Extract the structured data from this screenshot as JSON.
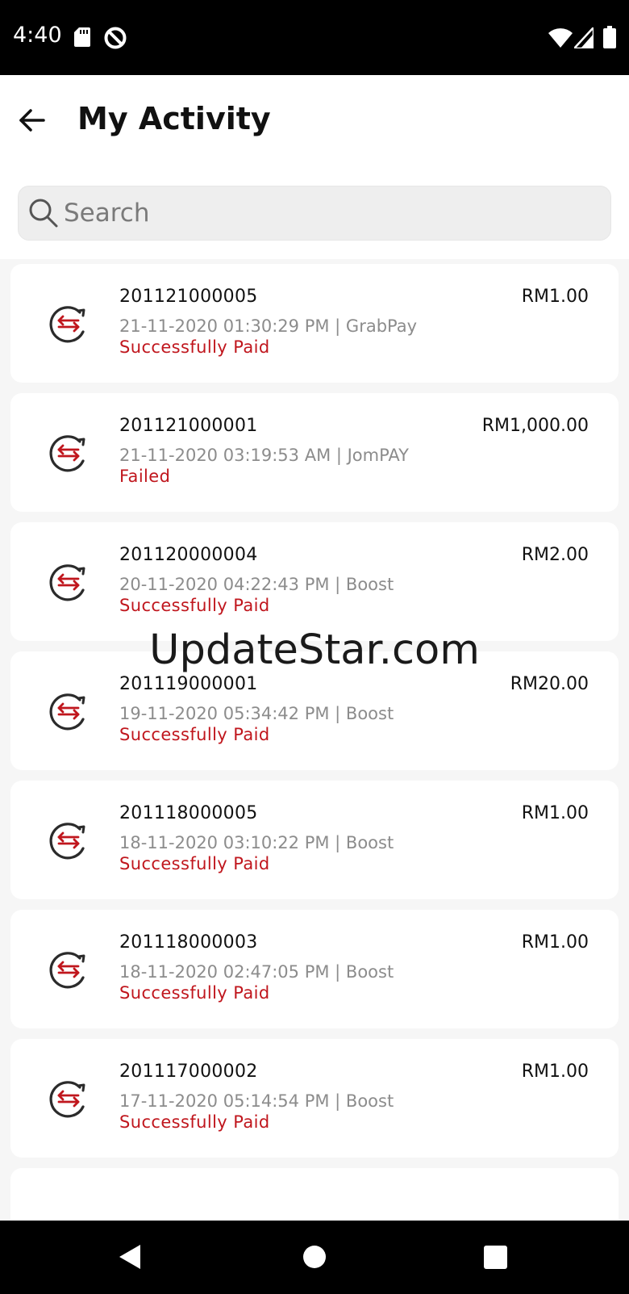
{
  "status_bar": {
    "time": "4:40",
    "icons": [
      "sd-card-icon",
      "do-not-disturb-icon",
      "wifi-icon",
      "signal-icon",
      "battery-icon"
    ]
  },
  "header": {
    "title": "My Activity",
    "back_icon": "arrow-left-icon"
  },
  "search": {
    "placeholder": "Search",
    "value": ""
  },
  "transactions": [
    {
      "id": "201121000005",
      "amount": "RM1.00",
      "meta": "21-11-2020 01:30:29 PM | GrabPay",
      "status": "Successfully Paid"
    },
    {
      "id": "201121000001",
      "amount": "RM1,000.00",
      "meta": "21-11-2020 03:19:53 AM | JomPAY",
      "status": "Failed"
    },
    {
      "id": "201120000004",
      "amount": "RM2.00",
      "meta": "20-11-2020 04:22:43 PM | Boost",
      "status": "Successfully Paid"
    },
    {
      "id": "201119000001",
      "amount": "RM20.00",
      "meta": "19-11-2020 05:34:42 PM | Boost",
      "status": "Successfully Paid"
    },
    {
      "id": "201118000005",
      "amount": "RM1.00",
      "meta": "18-11-2020 03:10:22 PM | Boost",
      "status": "Successfully Paid"
    },
    {
      "id": "201118000003",
      "amount": "RM1.00",
      "meta": "18-11-2020 02:47:05 PM | Boost",
      "status": "Successfully Paid"
    },
    {
      "id": "201117000002",
      "amount": "RM1.00",
      "meta": "17-11-2020 05:14:54 PM | Boost",
      "status": "Successfully Paid"
    }
  ],
  "watermark": "UpdateStar.com",
  "colors": {
    "status_red": "#c0161d",
    "icon_ring": "#2b2b2b",
    "background": "#f6f6f6"
  },
  "nav_bar": {
    "icons": [
      "nav-back-icon",
      "nav-home-icon",
      "nav-recents-icon"
    ]
  }
}
